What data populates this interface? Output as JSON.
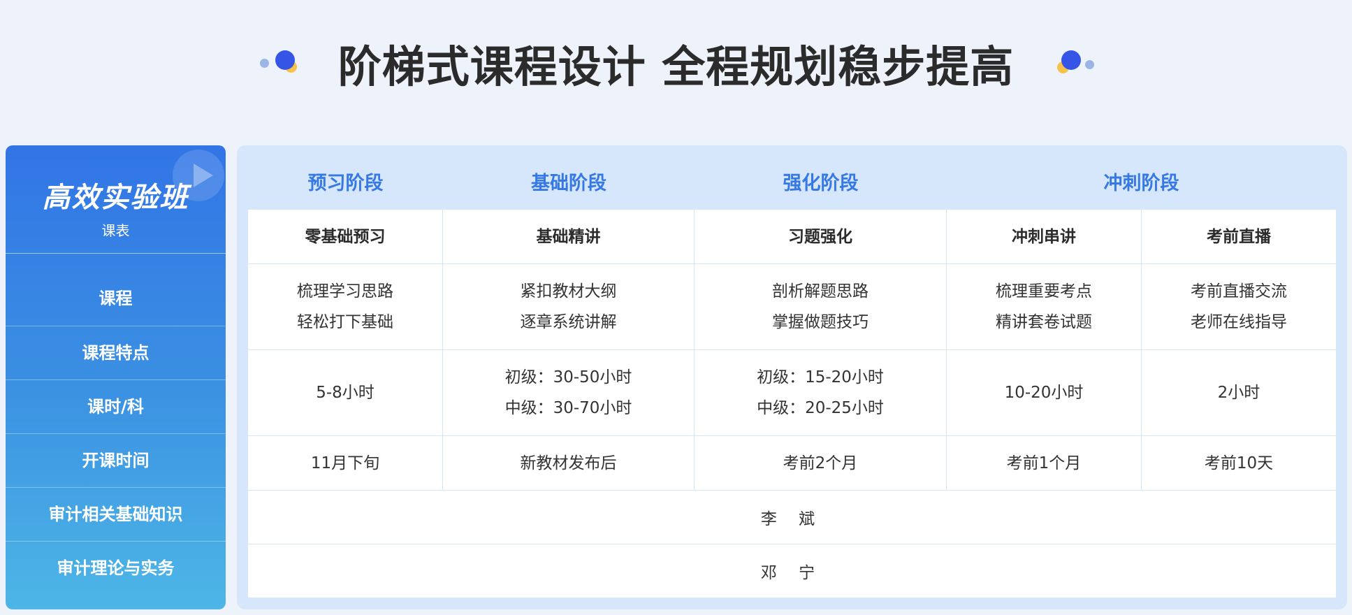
{
  "header": {
    "title": "阶梯式课程设计 全程规划稳步提高",
    "accent_colors": [
      "#3455e6",
      "#f6c24a",
      "#9bb5e6"
    ]
  },
  "left_panel": {
    "class_name": "高效实验班",
    "schedule_label": "课表",
    "rows": [
      "课程",
      "课程特点",
      "课时/科",
      "开课时间",
      "审计相关基础知识",
      "审计理论与实务"
    ]
  },
  "stages": [
    "预习阶段",
    "基础阶段",
    "强化阶段",
    "冲刺阶段"
  ],
  "courses": [
    "零基础预习",
    "基础精讲",
    "习题强化",
    "冲刺串讲",
    "考前直播"
  ],
  "features": [
    [
      "梳理学习思路",
      "轻松打下基础"
    ],
    [
      "紧扣教材大纲",
      "逐章系统讲解"
    ],
    [
      "剖析解题思路",
      "掌握做题技巧"
    ],
    [
      "梳理重要考点",
      "精讲套卷试题"
    ],
    [
      "考前直播交流",
      "老师在线指导"
    ]
  ],
  "hours": [
    [
      "5-8小时"
    ],
    [
      "初级：30-50小时",
      "中级：30-70小时"
    ],
    [
      "初级：15-20小时",
      "中级：20-25小时"
    ],
    [
      "10-20小时"
    ],
    [
      "2小时"
    ]
  ],
  "start_times": [
    "11月下旬",
    "新教材发布后",
    "考前2个月",
    "考前1个月",
    "考前10天"
  ],
  "teachers": [
    "李 斌",
    "邓 宁"
  ]
}
